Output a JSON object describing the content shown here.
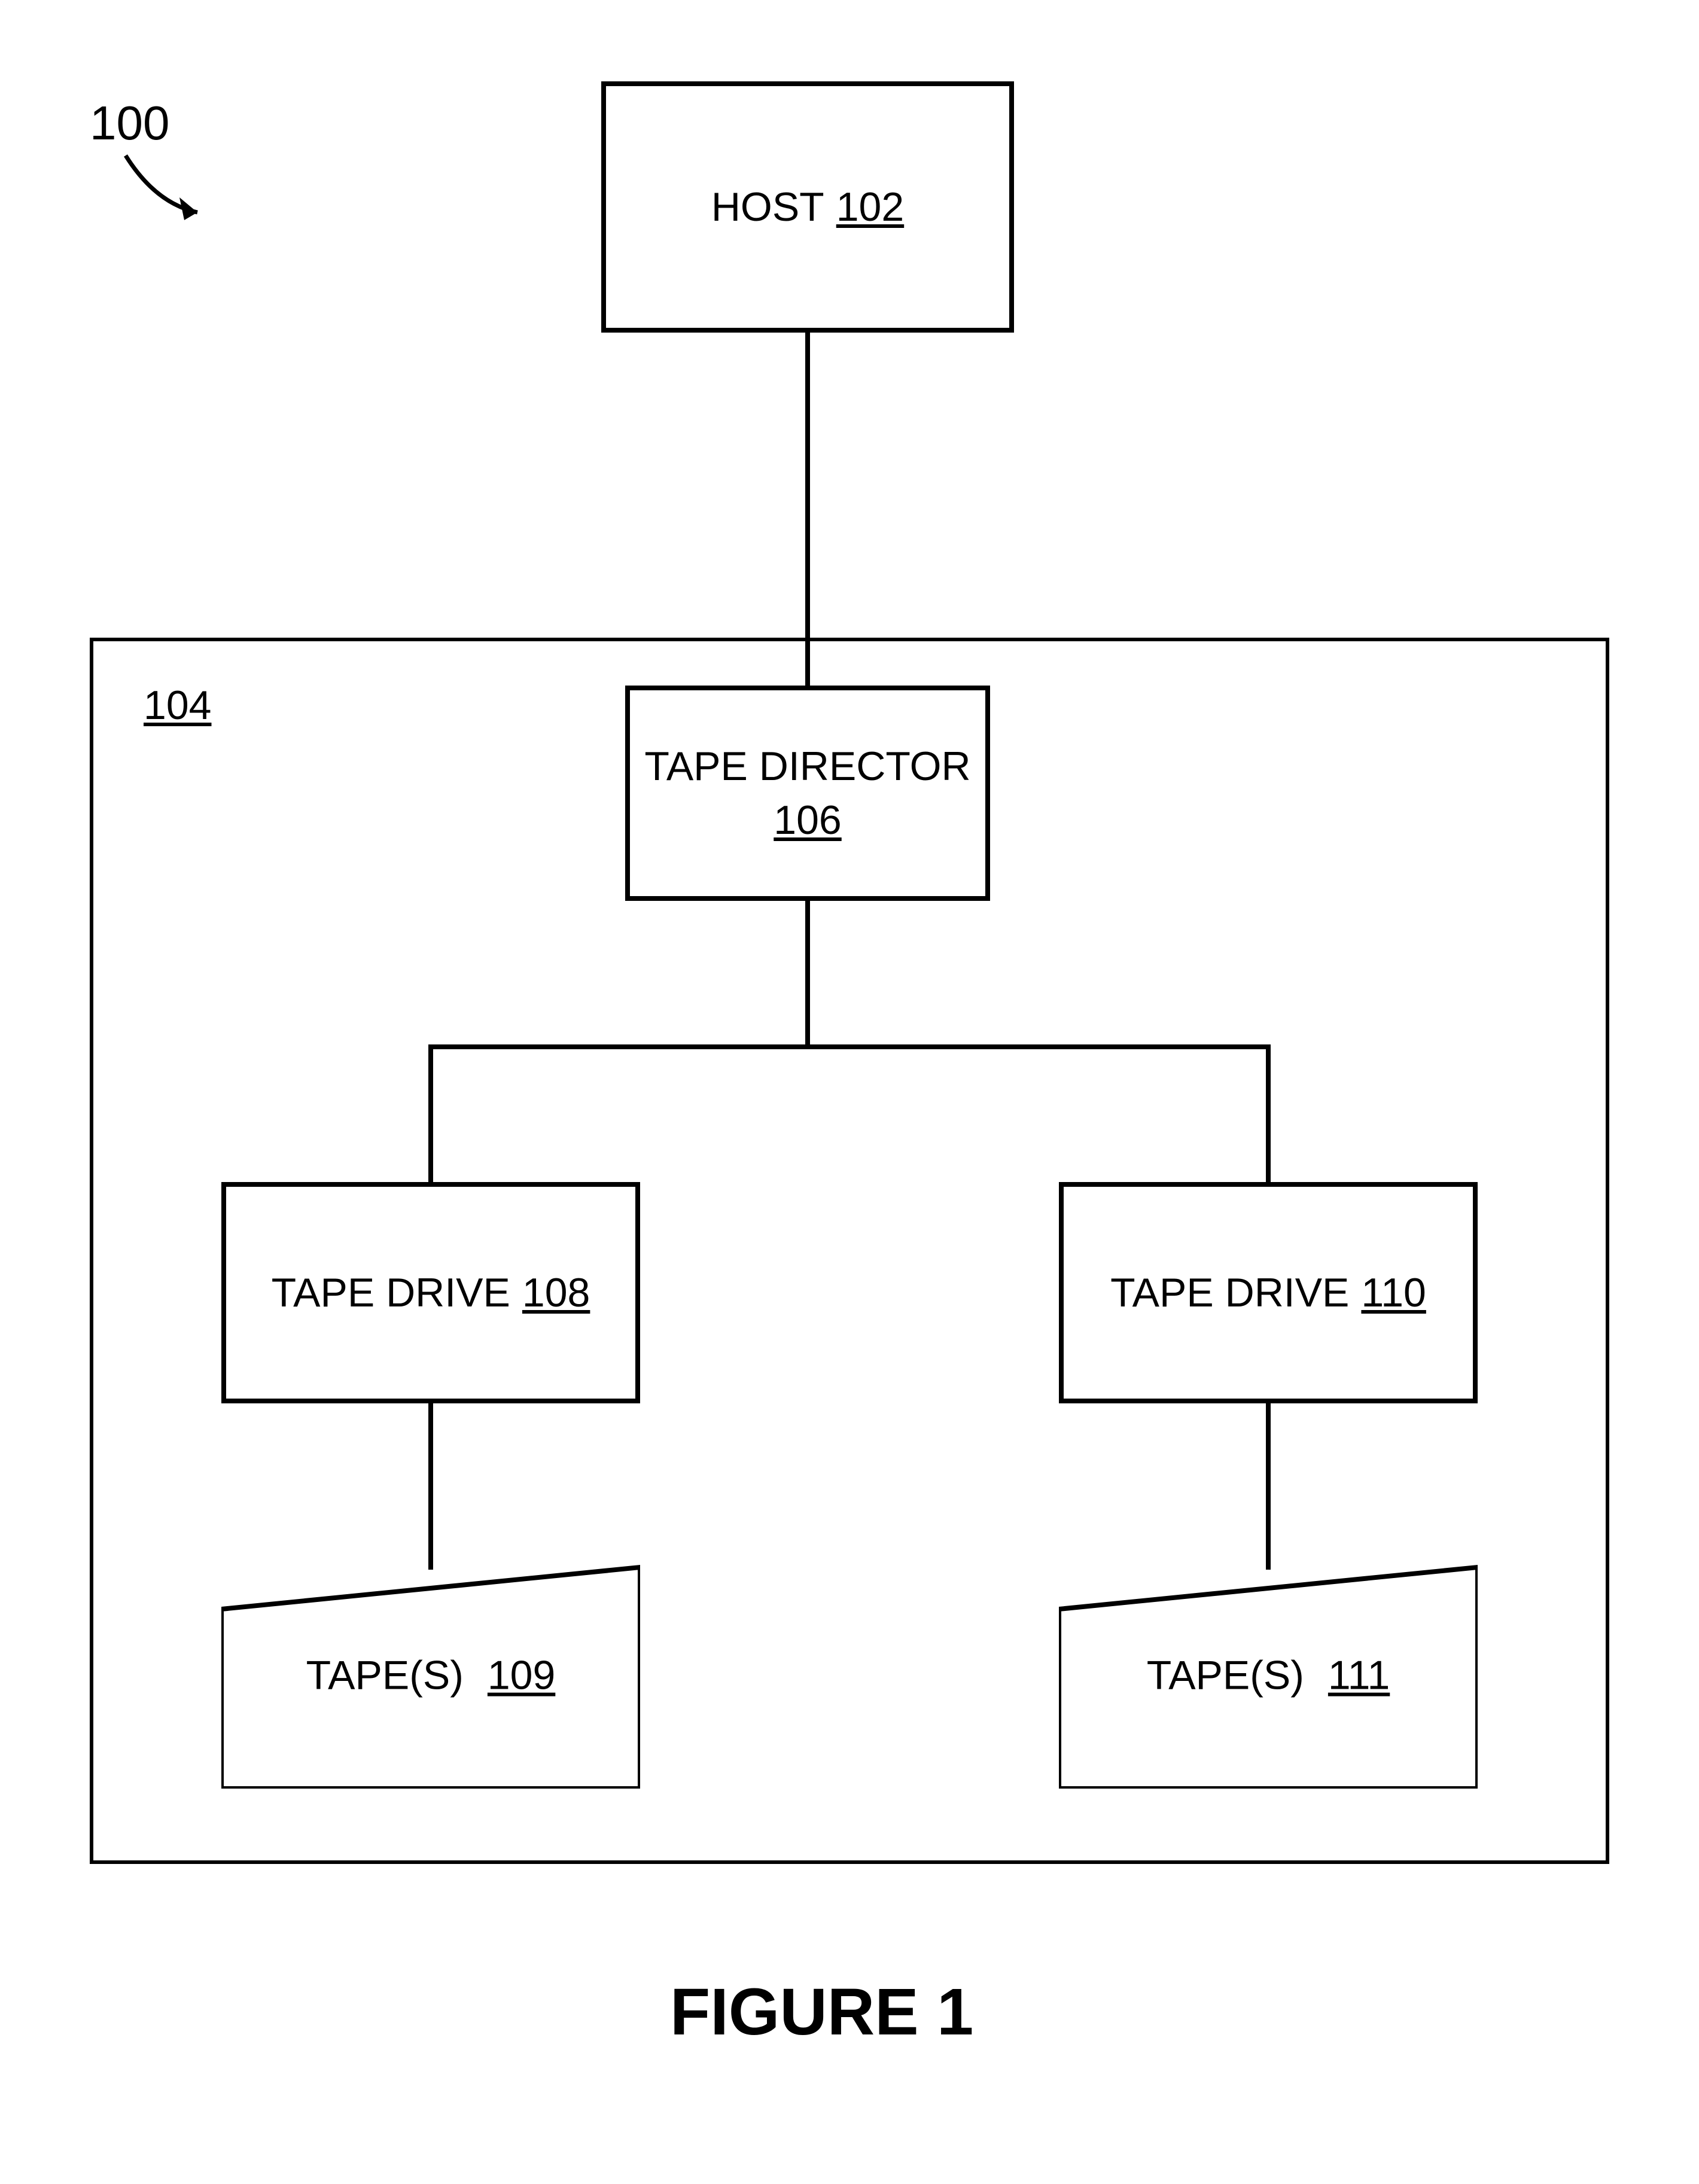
{
  "figure": {
    "ref_label": "100",
    "title": "FIGURE 1"
  },
  "container": {
    "ref": "104"
  },
  "blocks": {
    "host": {
      "name": "HOST",
      "ref": "102"
    },
    "tape_director": {
      "name": "TAPE DIRECTOR",
      "ref": "106"
    },
    "drive_left": {
      "name": "TAPE DRIVE",
      "ref": "108"
    },
    "drive_right": {
      "name": "TAPE DRIVE",
      "ref": "110"
    },
    "tape_left": {
      "name": "TAPE(S)",
      "ref": "109"
    },
    "tape_right": {
      "name": "TAPE(S)",
      "ref": "111"
    }
  }
}
